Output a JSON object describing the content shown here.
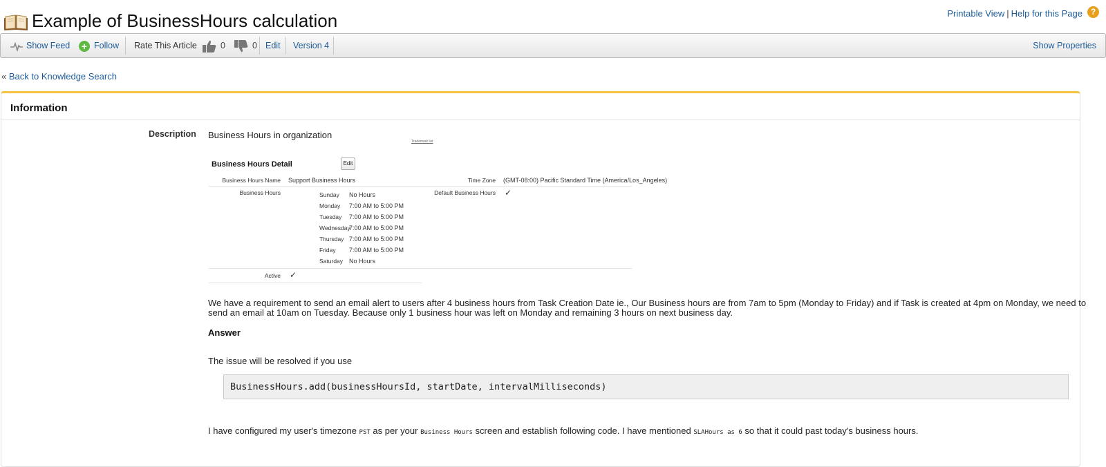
{
  "header": {
    "title": "Example of BusinessHours calculation",
    "printable_view": "Printable View",
    "separator": "|",
    "help_link": "Help for this Page",
    "help_badge": "?"
  },
  "toolbar": {
    "show_feed": "Show Feed",
    "follow": "Follow",
    "rate_label": "Rate This Article",
    "thumbs_up_count": "0",
    "thumbs_down_count": "0",
    "edit": "Edit",
    "version": "Version 4",
    "show_properties": "Show Properties"
  },
  "back_link": {
    "prefix": "«",
    "label": "Back to Knowledge Search"
  },
  "info": {
    "section_title": "Information",
    "description_label": "Description",
    "intro": "Business Hours in organization",
    "embedded": {
      "tiny_link": "Trademark list",
      "title": "Business Hours Detail",
      "edit_button": "Edit",
      "name_label": "Business Hours Name",
      "name_value": "Support Business Hours",
      "timezone_label": "Time Zone",
      "timezone_value": "(GMT-08:00) Pacific Standard Time (America/Los_Angeles)",
      "hours_label": "Business Hours",
      "default_label": "Default Business Hours",
      "default_value": "✓",
      "days": [
        {
          "day": "Sunday",
          "hours": "No Hours"
        },
        {
          "day": "Monday",
          "hours": "7:00 AM to 5:00 PM"
        },
        {
          "day": "Tuesday",
          "hours": "7:00 AM to 5:00 PM"
        },
        {
          "day": "Wednesday",
          "hours": "7:00 AM to 5:00 PM"
        },
        {
          "day": "Thursday",
          "hours": "7:00 AM to 5:00 PM"
        },
        {
          "day": "Friday",
          "hours": "7:00 AM to 5:00 PM"
        },
        {
          "day": "Saturday",
          "hours": "No Hours"
        }
      ],
      "active_label": "Active",
      "active_value": "✓"
    },
    "requirement_line1": "We have a requirement to send an email alert to users after 4 business hours from Task Creation Date ie., Our Business hours are from 7am to 5pm (Monday to Friday) and if Task is created at 4pm on Monday, we need to",
    "requirement_line2": "send an email at 10am on Tuesday. Because only 1 business hour was left on Monday and remaining 3 hours on next business day.",
    "answer_heading": "Answer",
    "answer_intro": "The issue will be resolved if you use",
    "code": "BusinessHours.add(businessHoursId, startDate, intervalMilliseconds)",
    "config_text_1": "I have configured my user's timezone ",
    "config_code_1": "PST",
    "config_text_2": " as per your ",
    "config_code_2": "Business Hours",
    "config_text_3": " screen and establish following code. I have mentioned ",
    "config_code_3": "SLAHours as 6",
    "config_text_4": " so that it could past today's business hours."
  }
}
